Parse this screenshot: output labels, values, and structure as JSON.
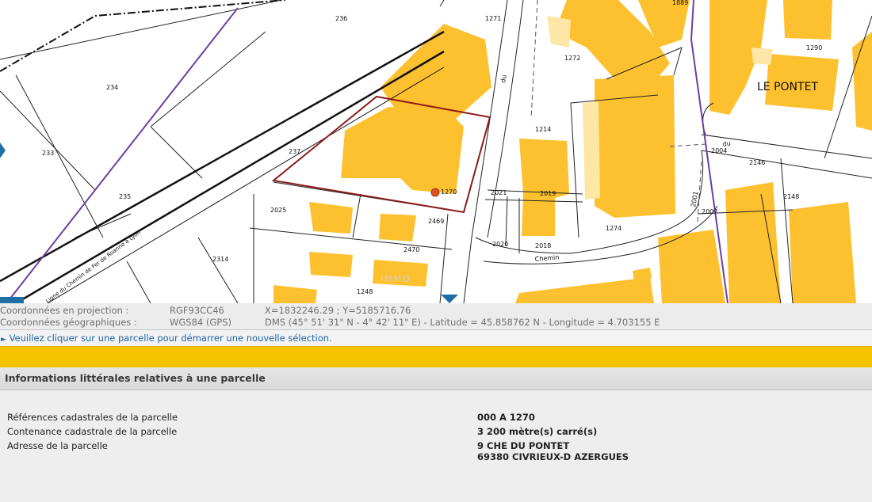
{
  "map": {
    "place_name": "LE PONTET",
    "rail_label": "Ligne du Chemin de Fer de Roanne à Lyon",
    "road_labels": [
      "du",
      "Chemin",
      "du"
    ],
    "watermark": "IMMO",
    "parcels": [
      "236",
      "1271",
      "1889",
      "234",
      "1272",
      "1290",
      "233",
      "237",
      "1214",
      "2004",
      "2146",
      "235",
      "1270",
      "2021",
      "2019",
      "2007",
      "2148",
      "2025",
      "2469",
      "2001",
      "1274",
      "2314",
      "2470",
      "2020",
      "2018",
      "1248"
    ],
    "selected_parcel": "1270",
    "colors": {
      "building": "#fdc02e",
      "selected_border": "#8b1a1a",
      "commune_boundary": "#6b3fa0",
      "marker": "#d9531e",
      "rail": "#111111"
    }
  },
  "coordinates": {
    "projection": {
      "label": "Coordonnées en projection :",
      "system": "RGF93CC46",
      "value": "X=1832246.29 ; Y=5185716.76"
    },
    "geographic": {
      "label": "Coordonnées géographiques :",
      "system": "WGS84 (GPS)",
      "value": "DMS (45° 51' 31\" N - 4° 42' 11\" E) - Latitude = 45.858762 N - Longitude = 4.703155 E"
    }
  },
  "notice": "Veuillez cliquer sur une parcelle pour démarrer une nouvelle sélection.",
  "panel": {
    "title": "Informations littérales relatives à une parcelle",
    "rows": [
      {
        "label": "Références cadastrales de la parcelle",
        "value": "000 A 1270"
      },
      {
        "label": "Contenance cadastrale de la parcelle",
        "value": "3 200 mètre(s) carré(s)"
      },
      {
        "label": "Adresse de la parcelle",
        "value": "9 CHE DU PONTET",
        "value2": "69380 CIVRIEUX-D AZERGUES"
      }
    ]
  }
}
